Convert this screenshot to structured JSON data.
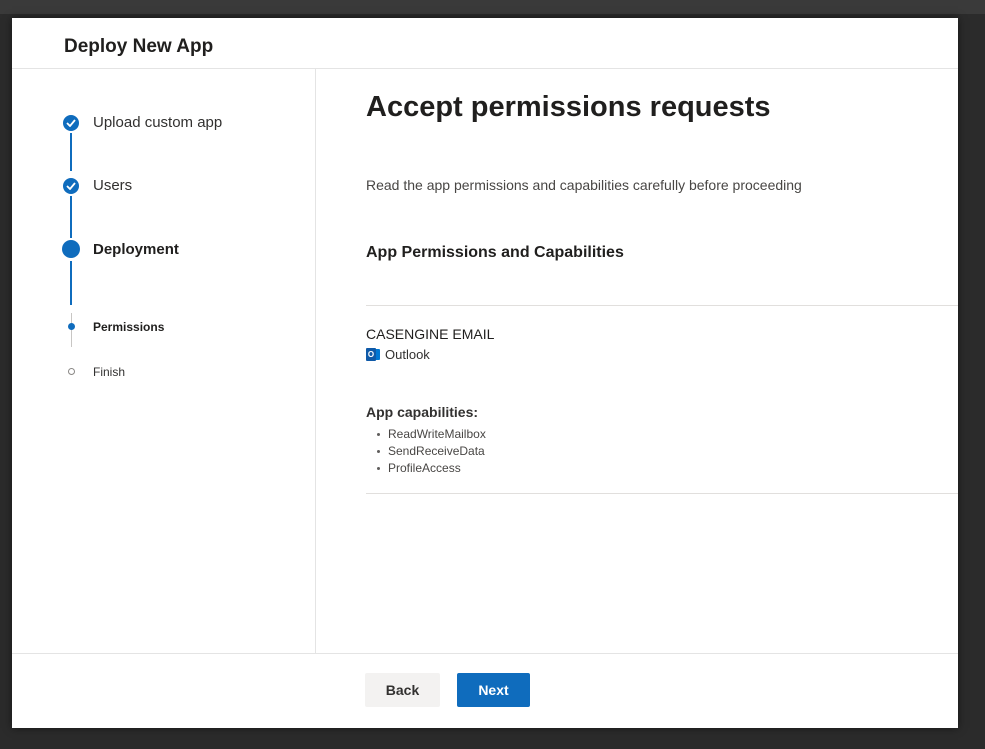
{
  "dialog": {
    "title": "Deploy New App"
  },
  "steps": {
    "upload": {
      "label": "Upload custom app",
      "status": "complete"
    },
    "users": {
      "label": "Users",
      "status": "complete"
    },
    "deployment": {
      "label": "Deployment",
      "status": "current"
    },
    "permissions": {
      "label": "Permissions",
      "status": "current-substep"
    },
    "finish": {
      "label": "Finish",
      "status": "pending"
    }
  },
  "main": {
    "title": "Accept permissions requests",
    "intro": "Read the app permissions and capabilities carefully before proceeding",
    "section_title": "App Permissions and Capabilities",
    "app_name": "CASENGINE EMAIL",
    "host": {
      "name": "Outlook",
      "icon": "outlook-icon",
      "icon_glyph": "O"
    },
    "capabilities_heading": "App capabilities:",
    "capabilities": [
      "ReadWriteMailbox",
      "SendReceiveData",
      "ProfileAccess"
    ]
  },
  "footer": {
    "back_label": "Back",
    "next_label": "Next"
  },
  "colors": {
    "accent": "#0f6cbd",
    "backdrop": "#2b2b2b"
  }
}
